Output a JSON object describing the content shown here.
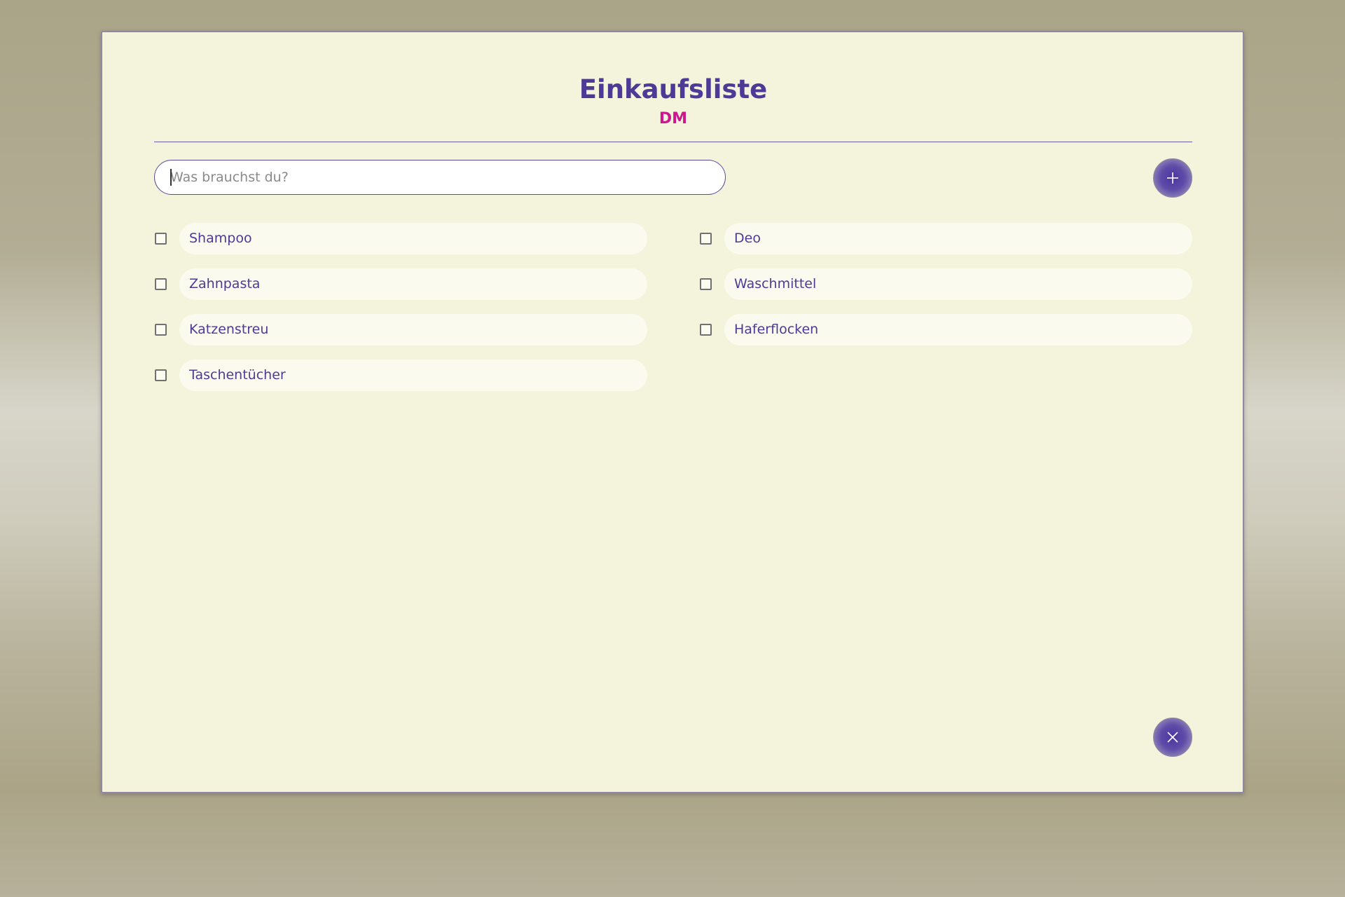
{
  "list": {
    "title": "Einkaufsliste",
    "store": "DM"
  },
  "input": {
    "placeholder": "Was brauchst du?",
    "value": ""
  },
  "buttons": {
    "add_icon": "plus-icon",
    "close_icon": "close-icon"
  },
  "items": {
    "left": [
      {
        "label": "Shampoo",
        "checked": false
      },
      {
        "label": "Zahnpasta",
        "checked": false
      },
      {
        "label": "Katzenstreu",
        "checked": false
      },
      {
        "label": "Taschentücher",
        "checked": false
      }
    ],
    "right": [
      {
        "label": "Deo",
        "checked": false
      },
      {
        "label": "Waschmittel",
        "checked": false
      },
      {
        "label": "Haferflocken",
        "checked": false
      }
    ]
  },
  "colors": {
    "accent": "#4d3a96",
    "store_accent": "#d0168e",
    "card_background": "#f4f4dc"
  }
}
